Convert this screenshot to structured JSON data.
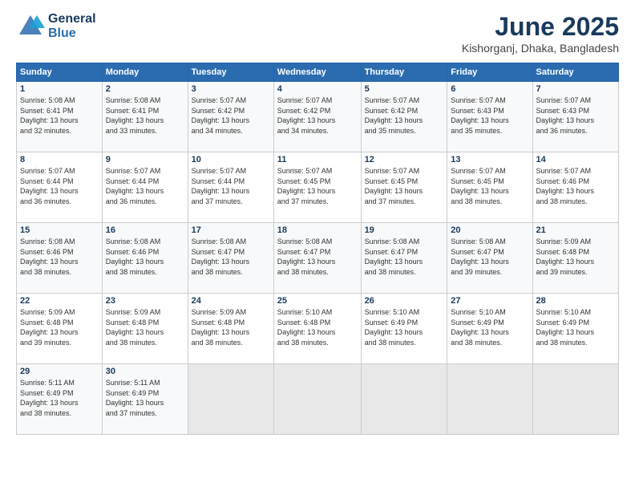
{
  "header": {
    "logo_line1": "General",
    "logo_line2": "Blue",
    "month_title": "June 2025",
    "location": "Kishorganj, Dhaka, Bangladesh"
  },
  "weekdays": [
    "Sunday",
    "Monday",
    "Tuesday",
    "Wednesday",
    "Thursday",
    "Friday",
    "Saturday"
  ],
  "weeks": [
    [
      {
        "day": "1",
        "sunrise": "Sunrise: 5:08 AM",
        "sunset": "Sunset: 6:41 PM",
        "daylight": "Daylight: 13 hours and 32 minutes."
      },
      {
        "day": "2",
        "sunrise": "Sunrise: 5:08 AM",
        "sunset": "Sunset: 6:41 PM",
        "daylight": "Daylight: 13 hours and 33 minutes."
      },
      {
        "day": "3",
        "sunrise": "Sunrise: 5:07 AM",
        "sunset": "Sunset: 6:42 PM",
        "daylight": "Daylight: 13 hours and 34 minutes."
      },
      {
        "day": "4",
        "sunrise": "Sunrise: 5:07 AM",
        "sunset": "Sunset: 6:42 PM",
        "daylight": "Daylight: 13 hours and 34 minutes."
      },
      {
        "day": "5",
        "sunrise": "Sunrise: 5:07 AM",
        "sunset": "Sunset: 6:42 PM",
        "daylight": "Daylight: 13 hours and 35 minutes."
      },
      {
        "day": "6",
        "sunrise": "Sunrise: 5:07 AM",
        "sunset": "Sunset: 6:43 PM",
        "daylight": "Daylight: 13 hours and 35 minutes."
      },
      {
        "day": "7",
        "sunrise": "Sunrise: 5:07 AM",
        "sunset": "Sunset: 6:43 PM",
        "daylight": "Daylight: 13 hours and 36 minutes."
      }
    ],
    [
      {
        "day": "8",
        "sunrise": "Sunrise: 5:07 AM",
        "sunset": "Sunset: 6:44 PM",
        "daylight": "Daylight: 13 hours and 36 minutes."
      },
      {
        "day": "9",
        "sunrise": "Sunrise: 5:07 AM",
        "sunset": "Sunset: 6:44 PM",
        "daylight": "Daylight: 13 hours and 36 minutes."
      },
      {
        "day": "10",
        "sunrise": "Sunrise: 5:07 AM",
        "sunset": "Sunset: 6:44 PM",
        "daylight": "Daylight: 13 hours and 37 minutes."
      },
      {
        "day": "11",
        "sunrise": "Sunrise: 5:07 AM",
        "sunset": "Sunset: 6:45 PM",
        "daylight": "Daylight: 13 hours and 37 minutes."
      },
      {
        "day": "12",
        "sunrise": "Sunrise: 5:07 AM",
        "sunset": "Sunset: 6:45 PM",
        "daylight": "Daylight: 13 hours and 37 minutes."
      },
      {
        "day": "13",
        "sunrise": "Sunrise: 5:07 AM",
        "sunset": "Sunset: 6:45 PM",
        "daylight": "Daylight: 13 hours and 38 minutes."
      },
      {
        "day": "14",
        "sunrise": "Sunrise: 5:07 AM",
        "sunset": "Sunset: 6:46 PM",
        "daylight": "Daylight: 13 hours and 38 minutes."
      }
    ],
    [
      {
        "day": "15",
        "sunrise": "Sunrise: 5:08 AM",
        "sunset": "Sunset: 6:46 PM",
        "daylight": "Daylight: 13 hours and 38 minutes."
      },
      {
        "day": "16",
        "sunrise": "Sunrise: 5:08 AM",
        "sunset": "Sunset: 6:46 PM",
        "daylight": "Daylight: 13 hours and 38 minutes."
      },
      {
        "day": "17",
        "sunrise": "Sunrise: 5:08 AM",
        "sunset": "Sunset: 6:47 PM",
        "daylight": "Daylight: 13 hours and 38 minutes."
      },
      {
        "day": "18",
        "sunrise": "Sunrise: 5:08 AM",
        "sunset": "Sunset: 6:47 PM",
        "daylight": "Daylight: 13 hours and 38 minutes."
      },
      {
        "day": "19",
        "sunrise": "Sunrise: 5:08 AM",
        "sunset": "Sunset: 6:47 PM",
        "daylight": "Daylight: 13 hours and 38 minutes."
      },
      {
        "day": "20",
        "sunrise": "Sunrise: 5:08 AM",
        "sunset": "Sunset: 6:47 PM",
        "daylight": "Daylight: 13 hours and 39 minutes."
      },
      {
        "day": "21",
        "sunrise": "Sunrise: 5:09 AM",
        "sunset": "Sunset: 6:48 PM",
        "daylight": "Daylight: 13 hours and 39 minutes."
      }
    ],
    [
      {
        "day": "22",
        "sunrise": "Sunrise: 5:09 AM",
        "sunset": "Sunset: 6:48 PM",
        "daylight": "Daylight: 13 hours and 39 minutes."
      },
      {
        "day": "23",
        "sunrise": "Sunrise: 5:09 AM",
        "sunset": "Sunset: 6:48 PM",
        "daylight": "Daylight: 13 hours and 38 minutes."
      },
      {
        "day": "24",
        "sunrise": "Sunrise: 5:09 AM",
        "sunset": "Sunset: 6:48 PM",
        "daylight": "Daylight: 13 hours and 38 minutes."
      },
      {
        "day": "25",
        "sunrise": "Sunrise: 5:10 AM",
        "sunset": "Sunset: 6:48 PM",
        "daylight": "Daylight: 13 hours and 38 minutes."
      },
      {
        "day": "26",
        "sunrise": "Sunrise: 5:10 AM",
        "sunset": "Sunset: 6:49 PM",
        "daylight": "Daylight: 13 hours and 38 minutes."
      },
      {
        "day": "27",
        "sunrise": "Sunrise: 5:10 AM",
        "sunset": "Sunset: 6:49 PM",
        "daylight": "Daylight: 13 hours and 38 minutes."
      },
      {
        "day": "28",
        "sunrise": "Sunrise: 5:10 AM",
        "sunset": "Sunset: 6:49 PM",
        "daylight": "Daylight: 13 hours and 38 minutes."
      }
    ],
    [
      {
        "day": "29",
        "sunrise": "Sunrise: 5:11 AM",
        "sunset": "Sunset: 6:49 PM",
        "daylight": "Daylight: 13 hours and 38 minutes."
      },
      {
        "day": "30",
        "sunrise": "Sunrise: 5:11 AM",
        "sunset": "Sunset: 6:49 PM",
        "daylight": "Daylight: 13 hours and 37 minutes."
      },
      null,
      null,
      null,
      null,
      null
    ]
  ]
}
